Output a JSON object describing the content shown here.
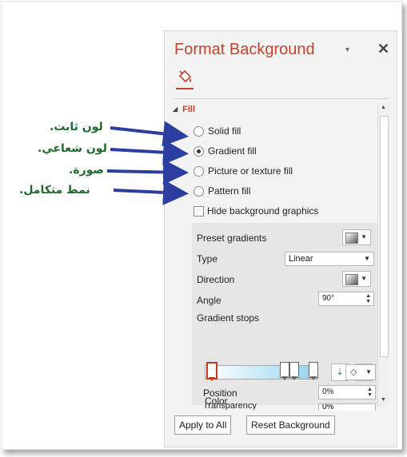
{
  "panel": {
    "title": "Format Background",
    "dropdown_icon": "▾",
    "close_icon": "✕",
    "category_icon": "paint-bucket-icon",
    "section": "Fill",
    "fill_options": [
      "Solid fill",
      "Gradient fill",
      "Picture or texture fill",
      "Pattern fill"
    ],
    "selected_fill": "Gradient fill",
    "hide_graphics_label": "Hide background graphics",
    "hide_graphics_checked": false,
    "gradient": {
      "preset_label": "Preset gradients",
      "type_label": "Type",
      "type_value": "Linear",
      "direction_label": "Direction",
      "angle_label": "Angle",
      "angle_value": "90°",
      "stops_label": "Gradient stops",
      "color_label": "Color",
      "position_label": "Position",
      "position_value": "0%",
      "transparency_label": "Transparency",
      "transparency_value": "0%"
    },
    "buttons": {
      "apply_all": "Apply to All",
      "reset": "Reset Background"
    }
  },
  "annotations": [
    "لون ثابت.",
    "لون شعاعي.",
    "صورة.",
    "نمط متكامل."
  ],
  "colors": {
    "title": "#c6432b",
    "annotation_text": "#1d6b2e",
    "arrow": "#2c3fa0"
  }
}
